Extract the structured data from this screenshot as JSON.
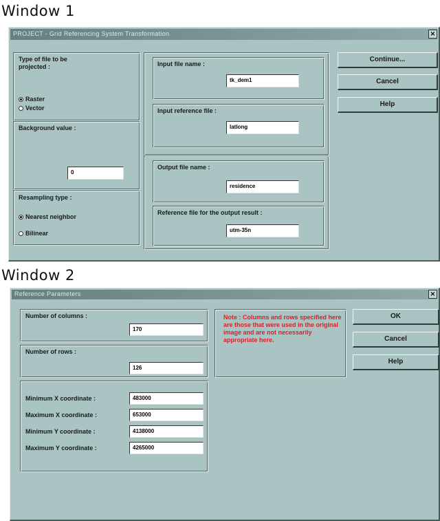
{
  "window1": {
    "caption": "Window 1",
    "title": "PROJECT - Grid Referencing System Transformation",
    "close": "×",
    "file_type": {
      "label": "Type of file to be projected :",
      "options": [
        {
          "label": "Raster",
          "selected": true
        },
        {
          "label": "Vector",
          "selected": false
        }
      ]
    },
    "background": {
      "label": "Background value :",
      "value": "0"
    },
    "resampling": {
      "label": "Resampling type :",
      "options": [
        {
          "label": "Nearest neighbor",
          "selected": true
        },
        {
          "label": "Bilinear",
          "selected": false
        }
      ]
    },
    "input_file": {
      "label": "Input file name :",
      "value": "tk_dem1"
    },
    "input_ref": {
      "label": "Input reference file :",
      "value": "latlong"
    },
    "output_file": {
      "label": "Output file name :",
      "value": "residence"
    },
    "output_ref": {
      "label": "Reference file for the output result :",
      "value": "utm-35n"
    },
    "buttons": {
      "continue": "Continue...",
      "cancel": "Cancel",
      "help": "Help"
    }
  },
  "window2": {
    "caption": "Window 2",
    "title": "Reference Parameters",
    "close": "×",
    "columns": {
      "label": "Number of columns :",
      "value": "170"
    },
    "rows": {
      "label": "Number of rows :",
      "value": "126"
    },
    "coords": {
      "min_x_label": "Minimum X coordinate :",
      "min_x": "483000",
      "max_x_label": "Maximum X coordinate :",
      "max_x": "653000",
      "min_y_label": "Minimum Y coordinate :",
      "min_y": "4138000",
      "max_y_label": "Maximum Y coordinate :",
      "max_y": "4265000"
    },
    "note": "Note : Columns and rows specified here are those that were used in the original image and are not necessarily appropriate here.",
    "buttons": {
      "ok": "OK",
      "cancel": "Cancel",
      "help": "Help"
    }
  },
  "colors": {
    "dialog_bg": "#a9c4c3",
    "titlebar": "#64807f",
    "note_text": "#d4232b"
  }
}
